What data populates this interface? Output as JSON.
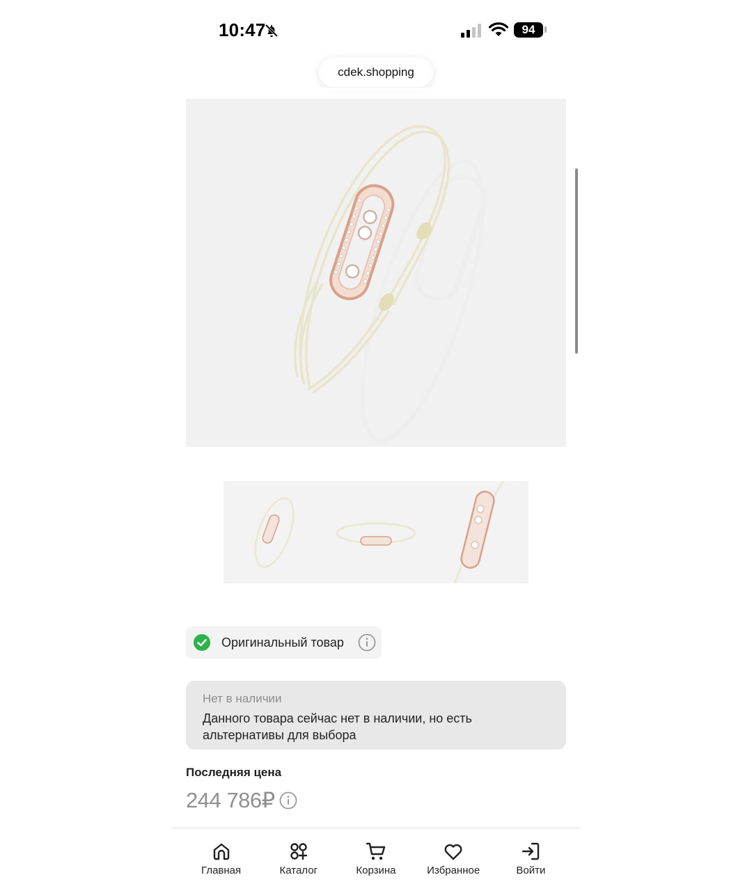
{
  "status_bar": {
    "time": "10:47",
    "battery": "94",
    "icons": [
      "bell-off-icon",
      "signal-icon",
      "wifi-icon",
      "battery-icon"
    ]
  },
  "browser": {
    "url": "cdek.shopping"
  },
  "product": {
    "gallery": {
      "main_image": "bracelet-photo",
      "thumbnails": [
        "bracelet-thumb-1",
        "bracelet-thumb-2",
        "bracelet-thumb-3"
      ]
    },
    "original_badge": {
      "label": "Оригинальный товар",
      "icon": "check-circle-icon",
      "color": "#2bb24c"
    },
    "stock": {
      "title": "Нет в наличии",
      "description": "Данного товара сейчас нет в наличии, но есть альтернативы для выбора"
    },
    "last_price_label": "Последняя цена",
    "price": "244 786₽"
  },
  "bottom_nav": {
    "items": [
      {
        "label": "Главная",
        "icon": "home-icon"
      },
      {
        "label": "Каталог",
        "icon": "catalog-icon"
      },
      {
        "label": "Корзина",
        "icon": "cart-icon"
      },
      {
        "label": "Избранное",
        "icon": "heart-icon"
      },
      {
        "label": "Войти",
        "icon": "login-icon"
      }
    ]
  }
}
